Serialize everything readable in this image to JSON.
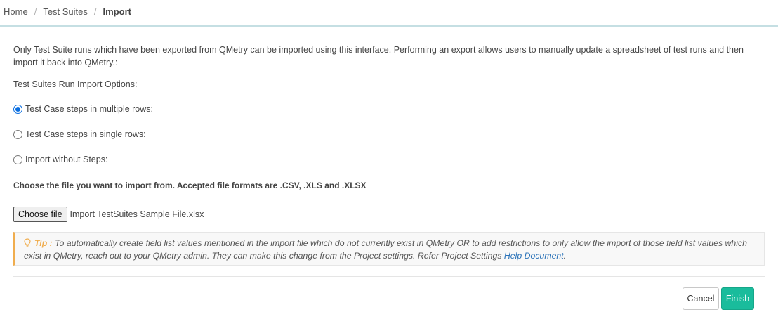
{
  "breadcrumb": {
    "home": "Home",
    "test_suites": "Test Suites",
    "current": "Import",
    "separator": "/"
  },
  "intro_text": "Only Test Suite runs which have been exported from QMetry can be imported using this interface. Performing an export allows users to manually update a spreadsheet of test runs and then import it back into QMetry.:",
  "options": {
    "title": "Test Suites Run Import Options:",
    "items": [
      {
        "label": "Test Case steps in multiple rows:",
        "checked": true
      },
      {
        "label": "Test Case steps in single rows:",
        "checked": false
      },
      {
        "label": "Import without Steps:",
        "checked": false
      }
    ]
  },
  "file": {
    "instruction": "Choose the file you want to import from. Accepted file formats are .CSV, .XLS and .XLSX",
    "button_label": "Choose file",
    "selected_file": "Import TestSuites Sample File.xlsx"
  },
  "tip": {
    "icon": "lightbulb-icon",
    "title": "Tip :",
    "text": "To automatically create field list values mentioned in the import file which do not currently exist in QMetry OR to add restrictions to only allow the import of those field list values which exist in QMetry, reach out to your QMetry admin. They can make this change from the Project settings. Refer Project Settings",
    "link_text": "Help Document",
    "end": ".",
    "accent_color": "#f0ad4e"
  },
  "actions": {
    "cancel_label": "Cancel",
    "finish_label": "Finish",
    "finish_color": "#1abc9c"
  }
}
